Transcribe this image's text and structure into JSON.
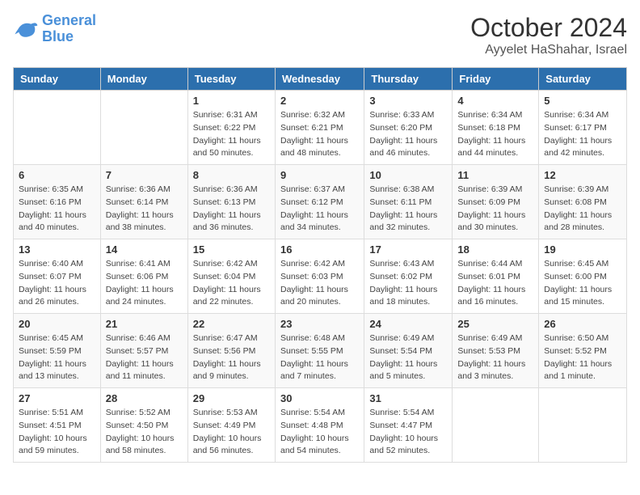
{
  "header": {
    "logo_general": "General",
    "logo_blue": "Blue",
    "month": "October 2024",
    "location": "Ayyelet HaShahar, Israel"
  },
  "weekdays": [
    "Sunday",
    "Monday",
    "Tuesday",
    "Wednesday",
    "Thursday",
    "Friday",
    "Saturday"
  ],
  "weeks": [
    [
      {
        "day": "",
        "info": ""
      },
      {
        "day": "",
        "info": ""
      },
      {
        "day": "1",
        "info": "Sunrise: 6:31 AM\nSunset: 6:22 PM\nDaylight: 11 hours and 50 minutes."
      },
      {
        "day": "2",
        "info": "Sunrise: 6:32 AM\nSunset: 6:21 PM\nDaylight: 11 hours and 48 minutes."
      },
      {
        "day": "3",
        "info": "Sunrise: 6:33 AM\nSunset: 6:20 PM\nDaylight: 11 hours and 46 minutes."
      },
      {
        "day": "4",
        "info": "Sunrise: 6:34 AM\nSunset: 6:18 PM\nDaylight: 11 hours and 44 minutes."
      },
      {
        "day": "5",
        "info": "Sunrise: 6:34 AM\nSunset: 6:17 PM\nDaylight: 11 hours and 42 minutes."
      }
    ],
    [
      {
        "day": "6",
        "info": "Sunrise: 6:35 AM\nSunset: 6:16 PM\nDaylight: 11 hours and 40 minutes."
      },
      {
        "day": "7",
        "info": "Sunrise: 6:36 AM\nSunset: 6:14 PM\nDaylight: 11 hours and 38 minutes."
      },
      {
        "day": "8",
        "info": "Sunrise: 6:36 AM\nSunset: 6:13 PM\nDaylight: 11 hours and 36 minutes."
      },
      {
        "day": "9",
        "info": "Sunrise: 6:37 AM\nSunset: 6:12 PM\nDaylight: 11 hours and 34 minutes."
      },
      {
        "day": "10",
        "info": "Sunrise: 6:38 AM\nSunset: 6:11 PM\nDaylight: 11 hours and 32 minutes."
      },
      {
        "day": "11",
        "info": "Sunrise: 6:39 AM\nSunset: 6:09 PM\nDaylight: 11 hours and 30 minutes."
      },
      {
        "day": "12",
        "info": "Sunrise: 6:39 AM\nSunset: 6:08 PM\nDaylight: 11 hours and 28 minutes."
      }
    ],
    [
      {
        "day": "13",
        "info": "Sunrise: 6:40 AM\nSunset: 6:07 PM\nDaylight: 11 hours and 26 minutes."
      },
      {
        "day": "14",
        "info": "Sunrise: 6:41 AM\nSunset: 6:06 PM\nDaylight: 11 hours and 24 minutes."
      },
      {
        "day": "15",
        "info": "Sunrise: 6:42 AM\nSunset: 6:04 PM\nDaylight: 11 hours and 22 minutes."
      },
      {
        "day": "16",
        "info": "Sunrise: 6:42 AM\nSunset: 6:03 PM\nDaylight: 11 hours and 20 minutes."
      },
      {
        "day": "17",
        "info": "Sunrise: 6:43 AM\nSunset: 6:02 PM\nDaylight: 11 hours and 18 minutes."
      },
      {
        "day": "18",
        "info": "Sunrise: 6:44 AM\nSunset: 6:01 PM\nDaylight: 11 hours and 16 minutes."
      },
      {
        "day": "19",
        "info": "Sunrise: 6:45 AM\nSunset: 6:00 PM\nDaylight: 11 hours and 15 minutes."
      }
    ],
    [
      {
        "day": "20",
        "info": "Sunrise: 6:45 AM\nSunset: 5:59 PM\nDaylight: 11 hours and 13 minutes."
      },
      {
        "day": "21",
        "info": "Sunrise: 6:46 AM\nSunset: 5:57 PM\nDaylight: 11 hours and 11 minutes."
      },
      {
        "day": "22",
        "info": "Sunrise: 6:47 AM\nSunset: 5:56 PM\nDaylight: 11 hours and 9 minutes."
      },
      {
        "day": "23",
        "info": "Sunrise: 6:48 AM\nSunset: 5:55 PM\nDaylight: 11 hours and 7 minutes."
      },
      {
        "day": "24",
        "info": "Sunrise: 6:49 AM\nSunset: 5:54 PM\nDaylight: 11 hours and 5 minutes."
      },
      {
        "day": "25",
        "info": "Sunrise: 6:49 AM\nSunset: 5:53 PM\nDaylight: 11 hours and 3 minutes."
      },
      {
        "day": "26",
        "info": "Sunrise: 6:50 AM\nSunset: 5:52 PM\nDaylight: 11 hours and 1 minute."
      }
    ],
    [
      {
        "day": "27",
        "info": "Sunrise: 5:51 AM\nSunset: 4:51 PM\nDaylight: 10 hours and 59 minutes."
      },
      {
        "day": "28",
        "info": "Sunrise: 5:52 AM\nSunset: 4:50 PM\nDaylight: 10 hours and 58 minutes."
      },
      {
        "day": "29",
        "info": "Sunrise: 5:53 AM\nSunset: 4:49 PM\nDaylight: 10 hours and 56 minutes."
      },
      {
        "day": "30",
        "info": "Sunrise: 5:54 AM\nSunset: 4:48 PM\nDaylight: 10 hours and 54 minutes."
      },
      {
        "day": "31",
        "info": "Sunrise: 5:54 AM\nSunset: 4:47 PM\nDaylight: 10 hours and 52 minutes."
      },
      {
        "day": "",
        "info": ""
      },
      {
        "day": "",
        "info": ""
      }
    ]
  ]
}
